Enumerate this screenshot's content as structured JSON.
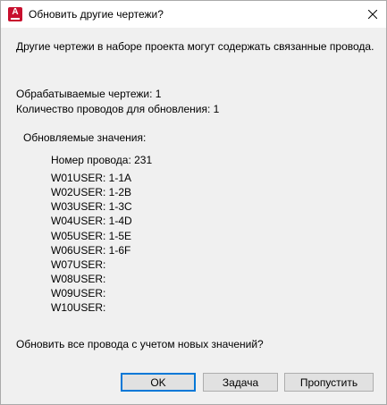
{
  "window": {
    "title": "Обновить другие чертежи?",
    "app_icon_letter": "A"
  },
  "message": {
    "intro": "Другие чертежи в наборе проекта могут содержать связанные провода.",
    "processed_drawings": "Обрабатываемые чертежи: 1",
    "wire_count": "Количество проводов для обновления: 1",
    "updated_values_label": "Обновляемые значения:",
    "wire_number": "Номер провода: 231",
    "user_values": [
      "W01USER: 1-1A",
      "W02USER: 1-2B",
      "W03USER: 1-3C",
      "W04USER: 1-4D",
      "W05USER: 1-5E",
      "W06USER: 1-6F",
      "W07USER:",
      "W08USER:",
      "W09USER:",
      "W10USER:"
    ],
    "question": "Обновить все провода с учетом новых значений?"
  },
  "buttons": {
    "ok": "OK",
    "task": "Задача",
    "skip": "Пропустить"
  },
  "colors": {
    "dialog_bg": "#f0f0f0",
    "titlebar_bg": "#ffffff",
    "app_icon": "#c8102e",
    "default_button_border": "#0078d7"
  },
  "icons": {
    "close": "close-icon",
    "app": "autocad-electrical-icon"
  }
}
